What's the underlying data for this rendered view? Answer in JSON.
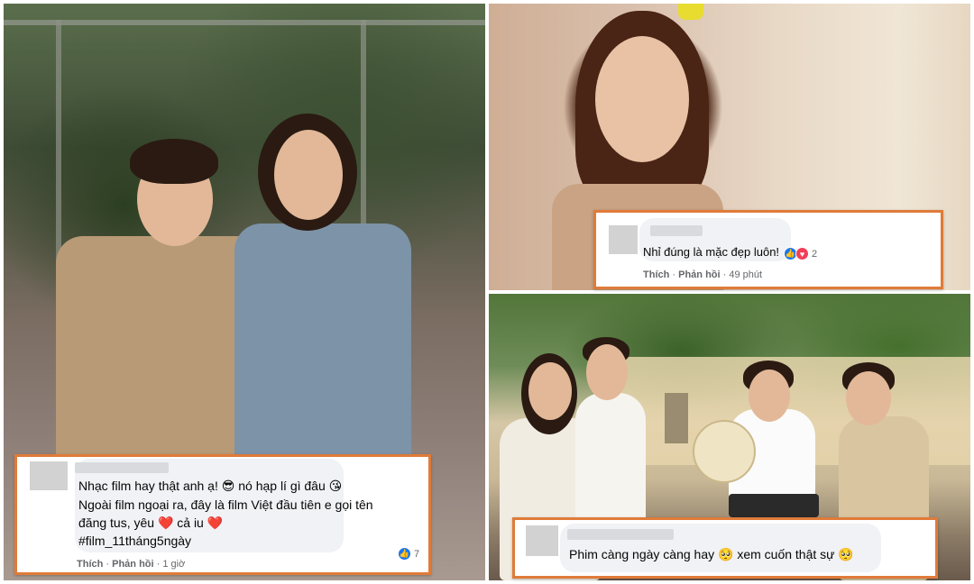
{
  "left_comment": {
    "lines": [
      "Nhạc film hay thật anh ạ! 😎 nó hạp lí gì đâu 😘",
      "Ngoài film ngoại ra, đây là film Việt đầu tiên e gọi tên",
      "đăng tus, yêu ❤️ cả iu ❤️",
      "#film_11tháng5ngày"
    ],
    "like_label": "Thích",
    "reply_label": "Phản hồi",
    "time": "1 giờ",
    "reaction_count": "7",
    "reaction_icons": [
      "like-icon"
    ]
  },
  "top_right_comment": {
    "text": "Nhỉ đúng là mặc đẹp luôn!",
    "like_label": "Thích",
    "reply_label": "Phản hồi",
    "time": "49 phút",
    "reaction_count": "2",
    "reaction_icons": [
      "like-icon",
      "love-icon"
    ]
  },
  "bottom_right_comment": {
    "text": "Phim càng ngày càng hay 🥺 xem cuốn thật sự 🥺"
  },
  "colors": {
    "frame_border": "#e07b39",
    "bubble_bg": "#f0f2f5",
    "meta_text": "#65676b",
    "like_blue": "#1877f2",
    "love_red": "#f33e58"
  }
}
